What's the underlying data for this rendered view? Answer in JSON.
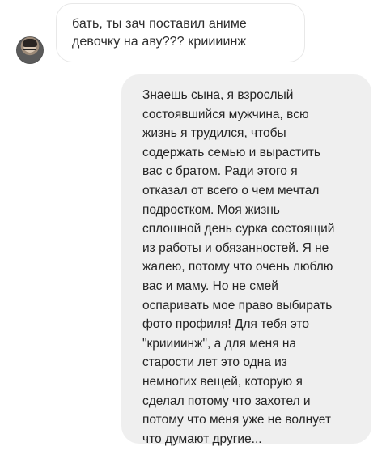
{
  "messages": {
    "incoming": {
      "avatar_icon": "user-avatar-icon",
      "text": "бать, ты зач поставил аниме\nдевочку на аву??? криииинж"
    },
    "outgoing": {
      "text": "Знаешь сына, я взрослый\nсостоявшийся мужчина, всю\nжизнь я трудился, чтобы\nсодержать семью и вырастить\nвас с братом. Ради этого я\nотказал от всего о чем мечтал\nподростком. Моя жизнь\nсплошной день сурка состоящий\nиз работы и обязанностей. Я не\nжалею, потому что очень люблю\nвас и маму. Но не смей\nоспаривать мое право выбирать\nфото профиля! Для тебя это\n\"криииинж\", а для меня на\nстарости лет это одна из\nнемногих вещей, которую я\nсделал потому что захотел и\nпотому что меня уже не волнует\nчто думают другие..."
    }
  }
}
